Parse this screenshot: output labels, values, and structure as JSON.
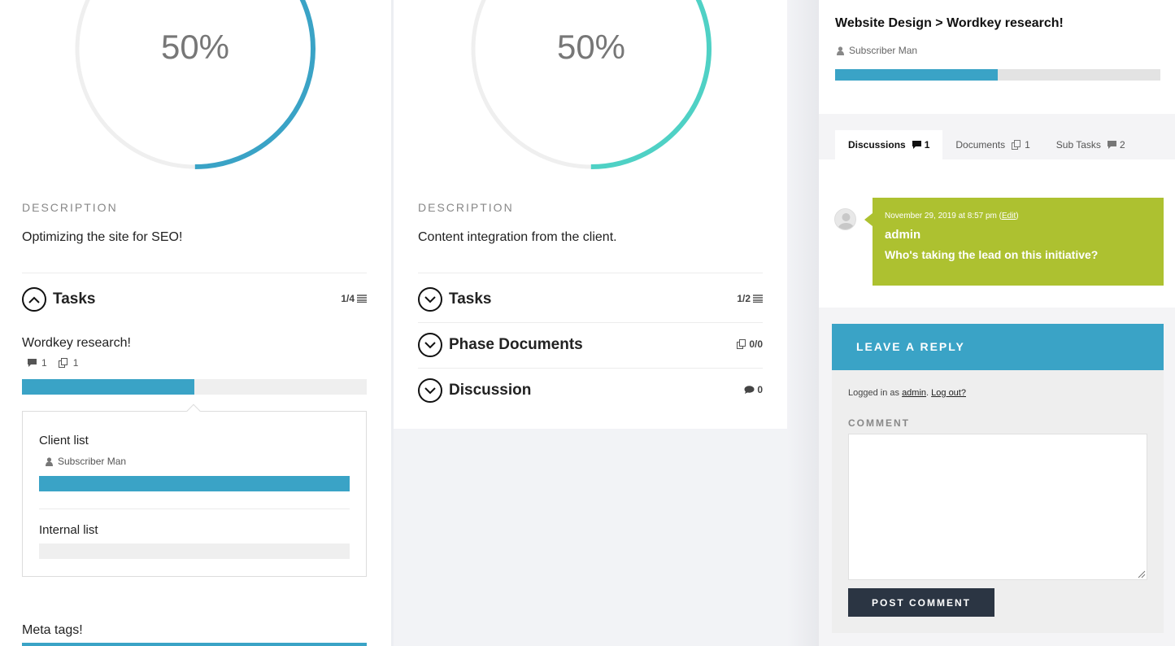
{
  "phases": [
    {
      "percent_label": "50%",
      "progress": 0.5,
      "ring_color": "#3aa3c6",
      "description_label": "DESCRIPTION",
      "description": "Optimizing the site for SEO!",
      "tasks_label": "Tasks",
      "tasks_count": "1/4",
      "tasks": [
        {
          "title": "Wordkey research!",
          "comments": "1",
          "documents": "1",
          "progress": 0.5,
          "subtasks": [
            {
              "title": "Client list",
              "assignee": "Subscriber Man",
              "progress": 1.0
            },
            {
              "title": "Internal list",
              "progress": 0.0
            }
          ]
        },
        {
          "title": "Meta tags!",
          "progress": 1.0
        }
      ]
    },
    {
      "percent_label": "50%",
      "progress": 0.5,
      "ring_color": "#4fd1c5",
      "description_label": "DESCRIPTION",
      "description": "Content integration from the client.",
      "sections": [
        {
          "label": "Tasks",
          "count": "1/2"
        },
        {
          "label": "Phase Documents",
          "count": "0/0"
        },
        {
          "label": "Discussion",
          "count": "0"
        }
      ]
    }
  ],
  "detail": {
    "breadcrumb": "Website Design > Wordkey research!",
    "assignee": "Subscriber Man",
    "progress": 0.5,
    "tabs": [
      {
        "label": "Discussions",
        "count": "1"
      },
      {
        "label": "Documents",
        "count": "1"
      },
      {
        "label": "Sub Tasks",
        "count": "2"
      }
    ],
    "comment": {
      "date": "November 29, 2019 at 8:57 pm",
      "edit_label": "Edit",
      "author": "admin",
      "text": "Who's taking the lead on this initiative?"
    },
    "reply": {
      "heading": "LEAVE A REPLY",
      "logged_prefix": "Logged in as ",
      "logged_user": "admin",
      "logout_label": "Log out?",
      "comment_label": "COMMENT",
      "comment_value": "",
      "button_label": "POST COMMENT"
    }
  },
  "colors": {
    "accent": "#3aa3c6",
    "teal": "#4fd1c5",
    "comment_bubble": "#adc130",
    "button_dark": "#2b3543"
  }
}
